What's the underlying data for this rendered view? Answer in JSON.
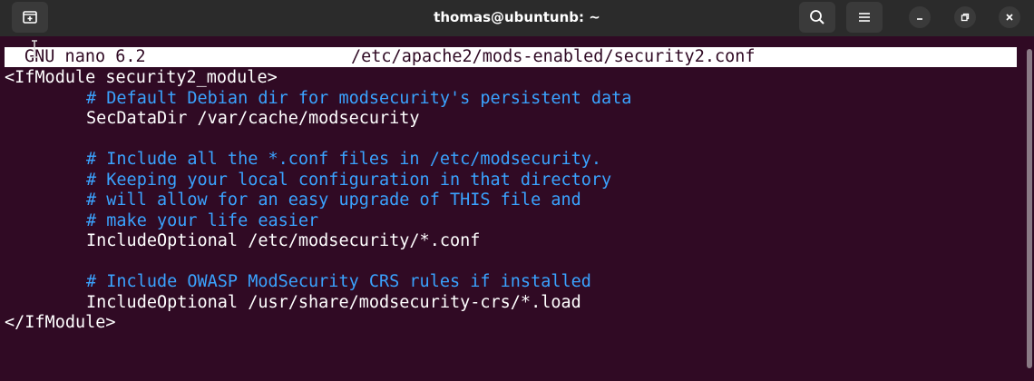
{
  "window": {
    "title": "thomas@ubuntunb: ~",
    "buttons": {
      "new_tab_icon": "new-tab-icon",
      "search_icon": "search-icon",
      "menu_icon": "hamburger-menu-icon",
      "minimize_icon": "minimize-icon",
      "maximize_icon": "restore-icon",
      "close_icon": "close-icon"
    }
  },
  "nano": {
    "version": "GNU nano 6.2",
    "filename": "/etc/apache2/mods-enabled/security2.conf"
  },
  "file_lines": [
    {
      "text": "<IfModule security2_module>",
      "type": "code",
      "indent": false
    },
    {
      "text": "# Default Debian dir for modsecurity's persistent data",
      "type": "comment",
      "indent": true
    },
    {
      "text": "SecDataDir /var/cache/modsecurity",
      "type": "code",
      "indent": true
    },
    {
      "text": "",
      "type": "blank",
      "indent": false
    },
    {
      "text": "# Include all the *.conf files in /etc/modsecurity.",
      "type": "comment",
      "indent": true
    },
    {
      "text": "# Keeping your local configuration in that directory",
      "type": "comment",
      "indent": true
    },
    {
      "text": "# will allow for an easy upgrade of THIS file and",
      "type": "comment",
      "indent": true
    },
    {
      "text": "# make your life easier",
      "type": "comment",
      "indent": true
    },
    {
      "text": "IncludeOptional /etc/modsecurity/*.conf",
      "type": "code",
      "indent": true
    },
    {
      "text": "",
      "type": "blank",
      "indent": false
    },
    {
      "text": "# Include OWASP ModSecurity CRS rules if installed",
      "type": "comment",
      "indent": true
    },
    {
      "text": "IncludeOptional /usr/share/modsecurity-crs/*.load",
      "type": "code",
      "indent": true
    },
    {
      "text": "</IfModule>",
      "type": "code",
      "indent": false
    }
  ],
  "colors": {
    "terminal_bg": "#300a24",
    "titlebar_bg": "#2b2b2b",
    "comment": "#3aa3ff",
    "text": "#ffffff"
  }
}
